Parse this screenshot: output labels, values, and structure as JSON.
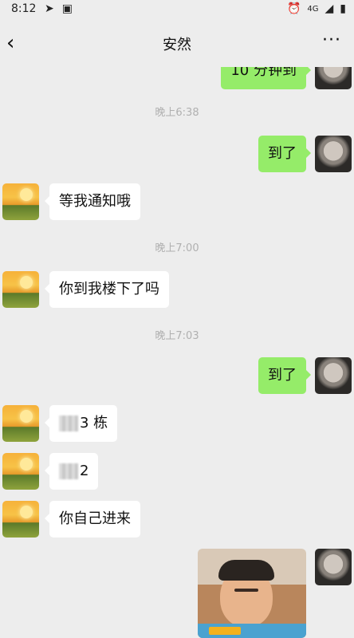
{
  "status_bar": {
    "time": "8:12",
    "network": "4G"
  },
  "nav": {
    "back_glyph": "‹",
    "title": "安然",
    "more_glyph": "···"
  },
  "messages": [
    {
      "type": "sent",
      "text": "10 分钟到"
    },
    {
      "type": "time",
      "text": "晚上6:38"
    },
    {
      "type": "sent",
      "text": "到了"
    },
    {
      "type": "recv",
      "text": "等我通知哦"
    },
    {
      "type": "time",
      "text": "晚上7:00"
    },
    {
      "type": "recv",
      "text": "你到我楼下了吗"
    },
    {
      "type": "time",
      "text": "晚上7:03"
    },
    {
      "type": "sent",
      "text": "到了"
    },
    {
      "type": "recv",
      "text": "3 栋"
    },
    {
      "type": "recv",
      "text": "2"
    },
    {
      "type": "recv",
      "text": "你自己进来"
    },
    {
      "type": "sent",
      "text": ""
    }
  ],
  "icons": {
    "telegram": "telegram-icon",
    "image": "image-icon",
    "alarm": "alarm-icon",
    "signal": "signal-icon",
    "battery": "battery-icon"
  }
}
